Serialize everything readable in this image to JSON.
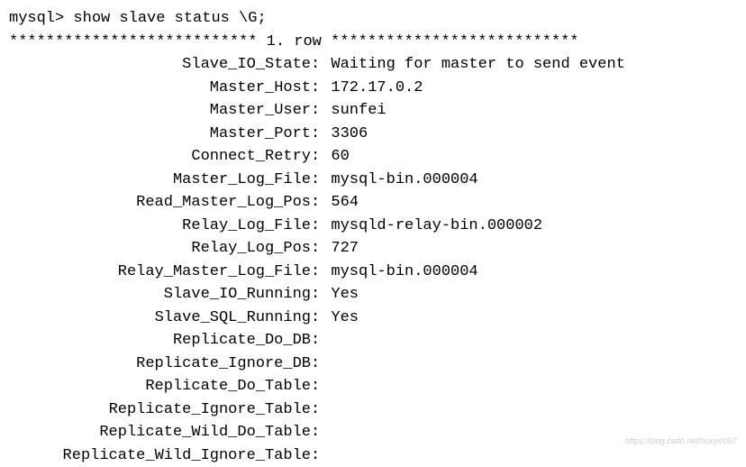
{
  "prompt": "mysql> ",
  "command": "show slave status \\G;",
  "separator_line": "*************************** 1. row ***************************",
  "fields": [
    {
      "key": "Slave_IO_State",
      "value": "Waiting for master to send event"
    },
    {
      "key": "Master_Host",
      "value": "172.17.0.2"
    },
    {
      "key": "Master_User",
      "value": "sunfei"
    },
    {
      "key": "Master_Port",
      "value": "3306"
    },
    {
      "key": "Connect_Retry",
      "value": "60"
    },
    {
      "key": "Master_Log_File",
      "value": "mysql-bin.000004"
    },
    {
      "key": "Read_Master_Log_Pos",
      "value": "564"
    },
    {
      "key": "Relay_Log_File",
      "value": "mysqld-relay-bin.000002"
    },
    {
      "key": "Relay_Log_Pos",
      "value": "727"
    },
    {
      "key": "Relay_Master_Log_File",
      "value": "mysql-bin.000004"
    },
    {
      "key": "Slave_IO_Running",
      "value": "Yes"
    },
    {
      "key": "Slave_SQL_Running",
      "value": "Yes"
    },
    {
      "key": "Replicate_Do_DB",
      "value": ""
    },
    {
      "key": "Replicate_Ignore_DB",
      "value": ""
    },
    {
      "key": "Replicate_Do_Table",
      "value": ""
    },
    {
      "key": "Replicate_Ignore_Table",
      "value": ""
    },
    {
      "key": "Replicate_Wild_Do_Table",
      "value": ""
    },
    {
      "key": "Replicate_Wild_Ignore_Table",
      "value": ""
    }
  ],
  "watermark": "https://blog.csdn.net/huxyin007"
}
